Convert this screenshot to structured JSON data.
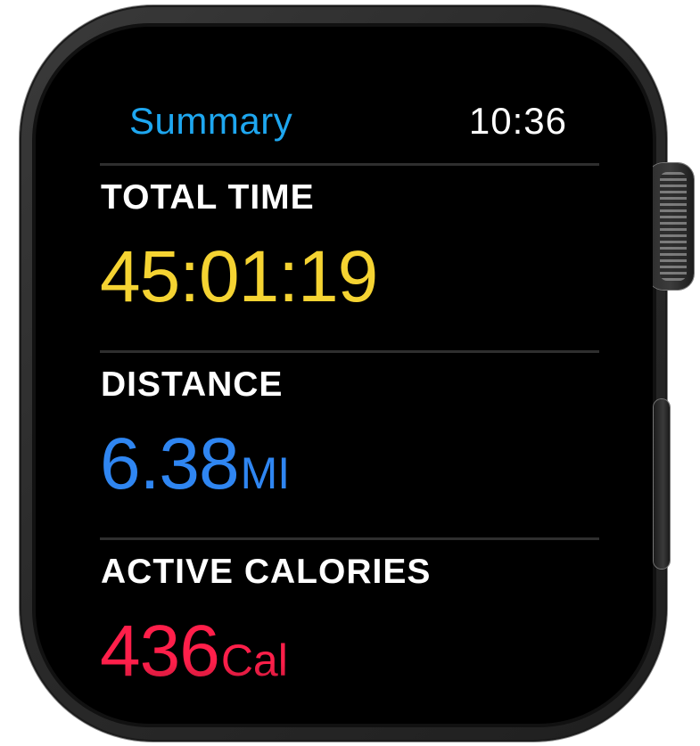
{
  "header": {
    "title": "Summary",
    "time": "10:36"
  },
  "metrics": [
    {
      "label": "TOTAL TIME",
      "value": "45:01:19",
      "unit": "",
      "color": "#f5d332"
    },
    {
      "label": "DISTANCE",
      "value": "6.38",
      "unit": "MI",
      "color": "#2f86f2"
    },
    {
      "label": "ACTIVE CALORIES",
      "value": "436",
      "unit": "Cal",
      "color": "#ff1f4a"
    }
  ],
  "colors": {
    "title_accent": "#1ea7f0",
    "screen_background": "#000000",
    "case": "#2a2a2a"
  },
  "icons": {
    "digital_crown": "digital-crown",
    "side_button": "side-button"
  }
}
